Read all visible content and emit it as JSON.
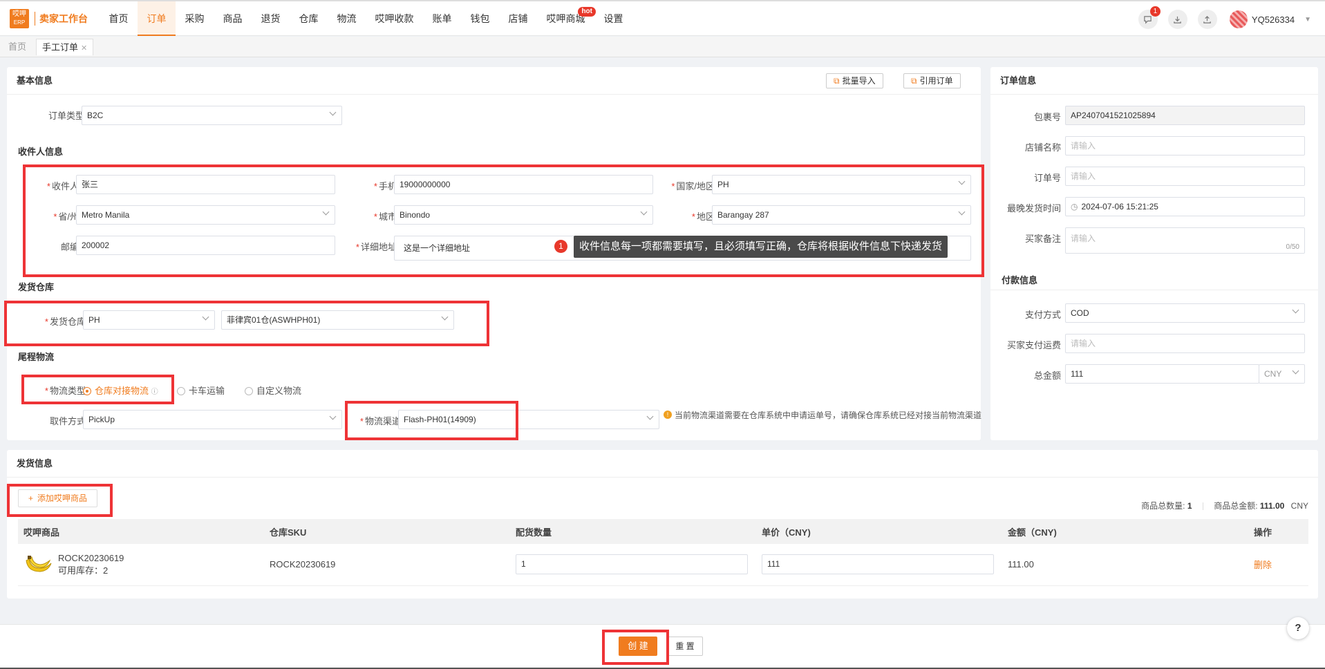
{
  "app": {
    "logo_text": "哎呷\nERP",
    "title": "卖家工作台"
  },
  "nav": {
    "items": [
      "首页",
      "订单",
      "采购",
      "商品",
      "退货",
      "仓库",
      "物流",
      "哎呷收款",
      "账单",
      "钱包",
      "店铺",
      "哎呷商城",
      "设置"
    ],
    "active": "订单",
    "hot_badge": "hot"
  },
  "topbar": {
    "notification_count": "1",
    "username": "YQ526334"
  },
  "tabs": [
    "首页",
    "手工订单"
  ],
  "basic": {
    "title": "基本信息",
    "batch_import": "批量导入",
    "ref_order": "引用订单",
    "order_type_label": "订单类型",
    "order_type_value": "B2C"
  },
  "receiver": {
    "title": "收件人信息",
    "name_label": "收件人",
    "name_value": "张三",
    "phone_label": "手机",
    "phone_value": "19000000000",
    "country_label": "国家/地区",
    "country_value": "PH",
    "province_label": "省/州",
    "province_value": "Metro Manila",
    "city_label": "城市",
    "city_value": "Binondo",
    "district_label": "地区",
    "district_value": "Barangay 287",
    "zip_label": "邮编",
    "zip_value": "200002",
    "address_label": "详细地址",
    "address_value": "这是一个详细地址"
  },
  "tooltip": {
    "step": "1",
    "text": "收件信息每一项都需要填写，且必须填写正确，仓库将根据收件信息下快递发货"
  },
  "warehouse": {
    "title": "发货仓库",
    "label": "发货仓库",
    "country_value": "PH",
    "warehouse_value": "菲律宾01仓(ASWHPH01)"
  },
  "lastmile": {
    "title": "尾程物流",
    "type_label": "物流类型",
    "options": [
      "仓库对接物流",
      "卡车运输",
      "自定义物流"
    ],
    "selected": "仓库对接物流",
    "pickup_label": "取件方式",
    "pickup_value": "PickUp",
    "channel_label": "物流渠道",
    "channel_value": "Flash-PH01(14909)",
    "notice": "当前物流渠道需要在仓库系统中申请运单号，请确保仓库系统已经对接当前物流渠道"
  },
  "order_info": {
    "title": "订单信息",
    "package_label": "包裹号",
    "package_value": "AP2407041521025894",
    "store_label": "店铺名称",
    "store_placeholder": "请输入",
    "order_no_label": "订单号",
    "order_no_placeholder": "请输入",
    "deadline_label": "最晚发货时间",
    "deadline_value": "2024-07-06 15:21:25",
    "remark_label": "买家备注",
    "remark_placeholder": "请输入",
    "remark_count": "0/50"
  },
  "payment": {
    "title": "付款信息",
    "method_label": "支付方式",
    "method_value": "COD",
    "shipping_label": "买家支付运费",
    "shipping_placeholder": "请输入",
    "total_label": "总金额",
    "total_value": "111",
    "currency": "CNY"
  },
  "shipping": {
    "title": "发货信息",
    "add_button": "添加哎呷商品",
    "total_qty_label": "商品总数量:",
    "total_qty": "1",
    "total_amount_label": "商品总金额:",
    "total_amount": "111.00",
    "total_currency": "CNY",
    "columns": [
      "哎呷商品",
      "仓库SKU",
      "配货数量",
      "单价（CNY)",
      "金额（CNY)",
      "操作"
    ],
    "row": {
      "product_name": "ROCK20230619",
      "stock_text": "可用库存：2",
      "sku": "ROCK20230619",
      "qty": "1",
      "price": "111",
      "amount": "111.00",
      "action": "删除"
    }
  },
  "footer": {
    "create": "创 建",
    "reset": "重 置",
    "help": "?"
  }
}
